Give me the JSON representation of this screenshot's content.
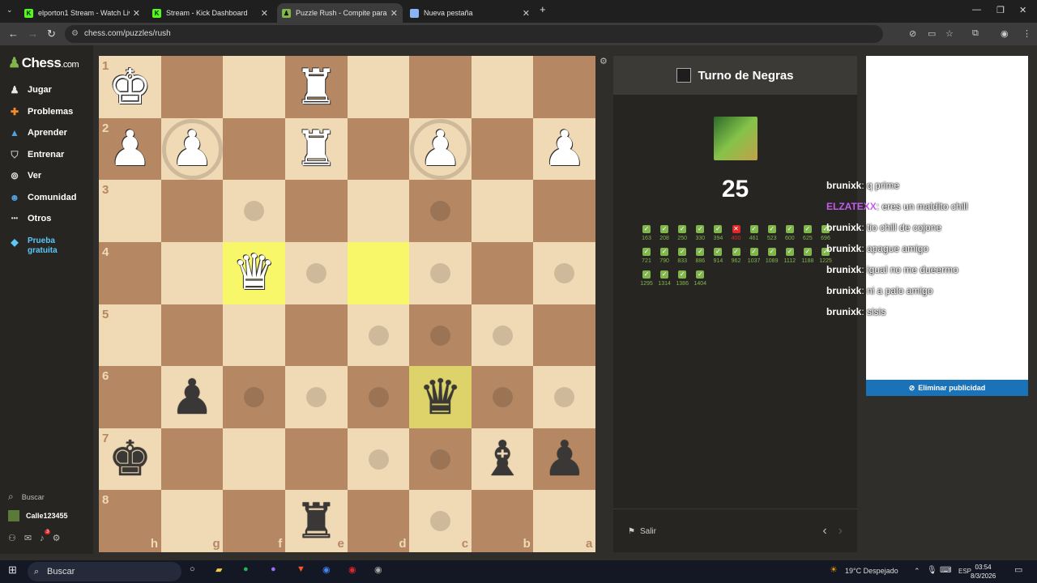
{
  "browser": {
    "tabs": [
      {
        "title": "elporton1 Stream - Watch Live o",
        "icon": "kick-icon",
        "color": "#53fc18",
        "active": false
      },
      {
        "title": "Stream - Kick Dashboard",
        "icon": "kick-icon",
        "color": "#53fc18",
        "active": false
      },
      {
        "title": "Puzzle Rush - Compite para",
        "icon": "chess-icon",
        "color": "#81b64c",
        "active": true
      },
      {
        "title": "Nueva pestaña",
        "icon": "chrome-icon",
        "color": "#8ab4f8",
        "active": false
      }
    ],
    "url": "chess.com/puzzles/rush"
  },
  "sidebar": {
    "logo": "Chess",
    "logo_suffix": ".com",
    "items": [
      {
        "label": "Jugar",
        "icon": "play-icon"
      },
      {
        "label": "Problemas",
        "icon": "puzzle-icon"
      },
      {
        "label": "Aprender",
        "icon": "learn-icon"
      },
      {
        "label": "Entrenar",
        "icon": "train-icon"
      },
      {
        "label": "Ver",
        "icon": "binoculars-icon"
      },
      {
        "label": "Comunidad",
        "icon": "community-icon"
      },
      {
        "label": "Otros",
        "icon": "more-icon"
      }
    ],
    "trial_line1": "Prueba",
    "trial_line2": "gratuita",
    "search": "Buscar",
    "user": "Calle123455",
    "notifications": "3"
  },
  "board": {
    "ranks": [
      "1",
      "2",
      "3",
      "4",
      "5",
      "6",
      "7",
      "8"
    ],
    "files": [
      "h",
      "g",
      "f",
      "e",
      "d",
      "c",
      "b",
      "a"
    ],
    "pieces": [
      {
        "sq": "a1",
        "glyph": "♚",
        "color": "w",
        "name": "white-king"
      },
      {
        "sq": "d1",
        "glyph": "♜",
        "color": "w",
        "name": "white-rook"
      },
      {
        "sq": "a2",
        "glyph": "♟",
        "color": "w",
        "name": "white-pawn"
      },
      {
        "sq": "b2",
        "glyph": "♟",
        "color": "w",
        "name": "white-pawn"
      },
      {
        "sq": "d2",
        "glyph": "♜",
        "color": "w",
        "name": "white-rook"
      },
      {
        "sq": "f2",
        "glyph": "♟",
        "color": "w",
        "name": "white-pawn"
      },
      {
        "sq": "h2",
        "glyph": "♟",
        "color": "w",
        "name": "white-pawn"
      },
      {
        "sq": "c4",
        "glyph": "♛",
        "color": "w",
        "name": "white-queen"
      },
      {
        "sq": "b6",
        "glyph": "♟",
        "color": "b",
        "name": "black-pawn"
      },
      {
        "sq": "f6",
        "glyph": "♛",
        "color": "b",
        "name": "black-queen"
      },
      {
        "sq": "a7",
        "glyph": "♚",
        "color": "b",
        "name": "black-king"
      },
      {
        "sq": "g7",
        "glyph": "♝",
        "color": "b",
        "name": "black-bishop"
      },
      {
        "sq": "h7",
        "glyph": "♟",
        "color": "b",
        "name": "black-pawn"
      },
      {
        "sq": "d8",
        "glyph": "♜",
        "color": "b",
        "name": "black-rook"
      }
    ],
    "highlights": [
      "c4",
      "e4",
      "f6"
    ],
    "dots": [
      "c3",
      "f3",
      "d4",
      "f4",
      "h4",
      "e5",
      "f5",
      "g5",
      "c6",
      "d6",
      "e6",
      "g6",
      "h6",
      "e7",
      "f7",
      "f8"
    ],
    "rings": [
      "b2",
      "f2"
    ]
  },
  "panel": {
    "title": "Turno de Negras",
    "score": "25",
    "results": [
      {
        "v": "163",
        "ok": true
      },
      {
        "v": "208",
        "ok": true
      },
      {
        "v": "250",
        "ok": true
      },
      {
        "v": "330",
        "ok": true
      },
      {
        "v": "394",
        "ok": true
      },
      {
        "v": "400",
        "ok": false
      },
      {
        "v": "461",
        "ok": true
      },
      {
        "v": "523",
        "ok": true
      },
      {
        "v": "600",
        "ok": true
      },
      {
        "v": "625",
        "ok": true
      },
      {
        "v": "696",
        "ok": true
      },
      {
        "v": "721",
        "ok": true
      },
      {
        "v": "790",
        "ok": true
      },
      {
        "v": "833",
        "ok": true
      },
      {
        "v": "886",
        "ok": true
      },
      {
        "v": "914",
        "ok": true
      },
      {
        "v": "962",
        "ok": true
      },
      {
        "v": "1037",
        "ok": true
      },
      {
        "v": "1089",
        "ok": true
      },
      {
        "v": "1112",
        "ok": true
      },
      {
        "v": "1188",
        "ok": true
      },
      {
        "v": "1225",
        "ok": true
      },
      {
        "v": "1295",
        "ok": true
      },
      {
        "v": "1314",
        "ok": true
      },
      {
        "v": "1386",
        "ok": true
      },
      {
        "v": "1404",
        "ok": true
      }
    ],
    "exit": "Salir"
  },
  "ad": {
    "button": "Eliminar publicidad"
  },
  "chat": [
    {
      "user": "brunixk",
      "msg": ": q prime",
      "purple": false
    },
    {
      "user": "ELZATEXX",
      "msg": ": eres un maldito chill",
      "purple": true
    },
    {
      "user": "brunixk",
      "msg": ": tio chill de cojone",
      "purple": false
    },
    {
      "user": "brunixk",
      "msg": ": apague amigo",
      "purple": false
    },
    {
      "user": "brunixk",
      "msg": ": igual no me dueermo",
      "purple": false
    },
    {
      "user": "brunixk",
      "msg": ": ni a palo amigo",
      "purple": false
    },
    {
      "user": "brunixk",
      "msg": ": sisis",
      "purple": false
    }
  ],
  "taskbar": {
    "search": "Buscar",
    "weather": "19°C  Despejado",
    "lang": "ESP",
    "time": "03:54",
    "date": "8/3/2026"
  }
}
